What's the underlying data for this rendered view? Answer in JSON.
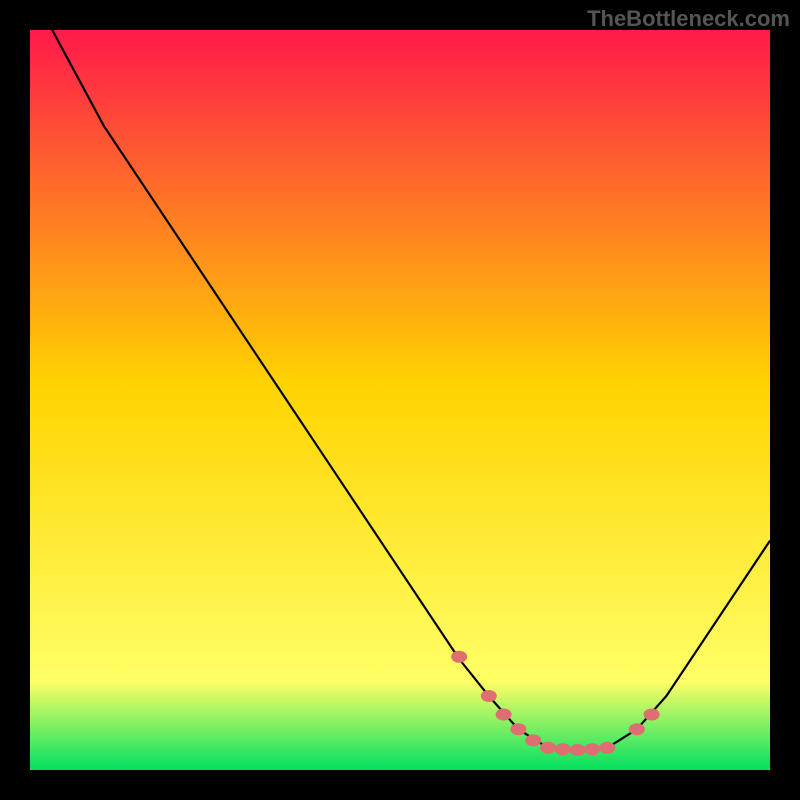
{
  "watermark": "TheBottleneck.com",
  "chart_data": {
    "type": "line",
    "title": "",
    "xlabel": "",
    "ylabel": "",
    "xlim": [
      0,
      100
    ],
    "ylim": [
      0,
      100
    ],
    "series": [
      {
        "name": "bottleneck-curve",
        "x": [
          3,
          10,
          20,
          30,
          40,
          50,
          58,
          62,
          66,
          70,
          74,
          78,
          82,
          86,
          100
        ],
        "y": [
          100,
          87,
          72,
          57,
          42,
          27,
          15,
          10,
          5.5,
          3,
          2.7,
          3,
          5.5,
          10,
          31
        ]
      }
    ],
    "markers": {
      "name": "highlight-zone",
      "x": [
        58,
        62,
        64,
        66,
        68,
        70,
        72,
        74,
        76,
        78,
        82,
        84
      ],
      "y": [
        15.3,
        10,
        7.5,
        5.5,
        4,
        3,
        2.8,
        2.7,
        2.8,
        3,
        5.5,
        7.5
      ]
    },
    "gradient_background": {
      "top": "#ff1a4a",
      "mid": "#ffd400",
      "lower": "#ffff66",
      "bottom": "#00e060"
    },
    "axes_visible": false,
    "grid": false
  }
}
